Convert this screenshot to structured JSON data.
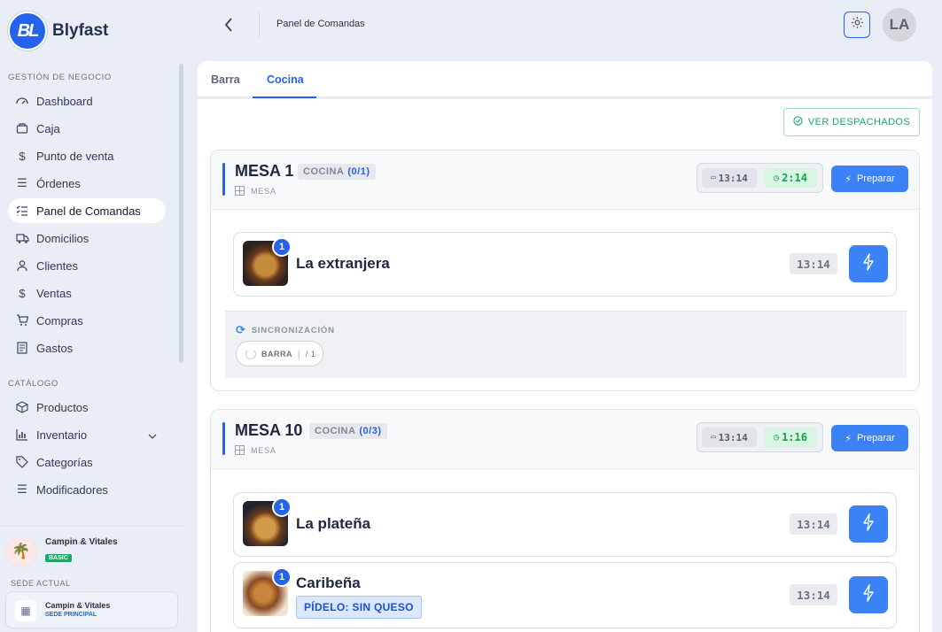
{
  "app": {
    "name": "Blyfast",
    "logo_mark": "BL"
  },
  "sidebar": {
    "section_business": "GESTIÓN DE NEGOCIO",
    "items_business": [
      {
        "label": "Dashboard",
        "icon": "dashboard-icon"
      },
      {
        "label": "Caja",
        "icon": "cash-register-icon"
      },
      {
        "label": "Punto de venta",
        "icon": "dollar-icon"
      },
      {
        "label": "Órdenes",
        "icon": "list-icon"
      },
      {
        "label": "Panel de Comandas",
        "icon": "checklist-icon",
        "active": true
      },
      {
        "label": "Domicilios",
        "icon": "delivery-truck-icon"
      },
      {
        "label": "Clientes",
        "icon": "user-icon"
      },
      {
        "label": "Ventas",
        "icon": "dollar-icon"
      },
      {
        "label": "Compras",
        "icon": "shopping-cart-icon"
      },
      {
        "label": "Gastos",
        "icon": "receipt-icon"
      }
    ],
    "section_catalog": "CATÁLOGO",
    "items_catalog": [
      {
        "label": "Productos",
        "icon": "box-icon"
      },
      {
        "label": "Inventario",
        "icon": "bar-chart-icon"
      },
      {
        "label": "Categorías",
        "icon": "tag-icon"
      },
      {
        "label": "Modificadores",
        "icon": "list-icon"
      }
    ],
    "business": {
      "name": "Campin & Vitales",
      "plan": "BASIC"
    },
    "sede": {
      "title": "SEDE ACTUAL",
      "name": "Campin & Vitales",
      "sub": "SEDE PRINCIPAL"
    }
  },
  "header": {
    "title": "Panel de Comandas",
    "avatar": "LA"
  },
  "tabs": [
    {
      "label": "Barra"
    },
    {
      "label": "Cocina",
      "active": true
    }
  ],
  "toolbar": {
    "ver_despachados": "VER DESPACHADOS"
  },
  "mesas": [
    {
      "title": "MESA 1",
      "chip_label": "COCINA",
      "chip_count": "(0/1)",
      "sub": "MESA",
      "time_start": "13:14",
      "elapsed": "2:14",
      "preparar": "Preparar",
      "items": [
        {
          "badge": "1",
          "name": "La extranjera",
          "time": "13:14"
        }
      ],
      "sync": {
        "title": "SINCRONIZACIÓN",
        "chip_label": "BARRA",
        "chip_count": "/ 1"
      }
    },
    {
      "title": "MESA 10",
      "chip_label": "COCINA",
      "chip_count": "(0/3)",
      "sub": "MESA",
      "time_start": "13:14",
      "elapsed": "1:16",
      "preparar": "Preparar",
      "items": [
        {
          "badge": "1",
          "name": "La plateña",
          "time": "13:14"
        },
        {
          "badge": "1",
          "name": "Caribeña",
          "note": "PÍDELO: SIN QUESO",
          "time": "13:14"
        }
      ]
    }
  ],
  "colors": {
    "accent": "#2563eb",
    "success": "#16a34a",
    "button": "#3b82f6"
  }
}
